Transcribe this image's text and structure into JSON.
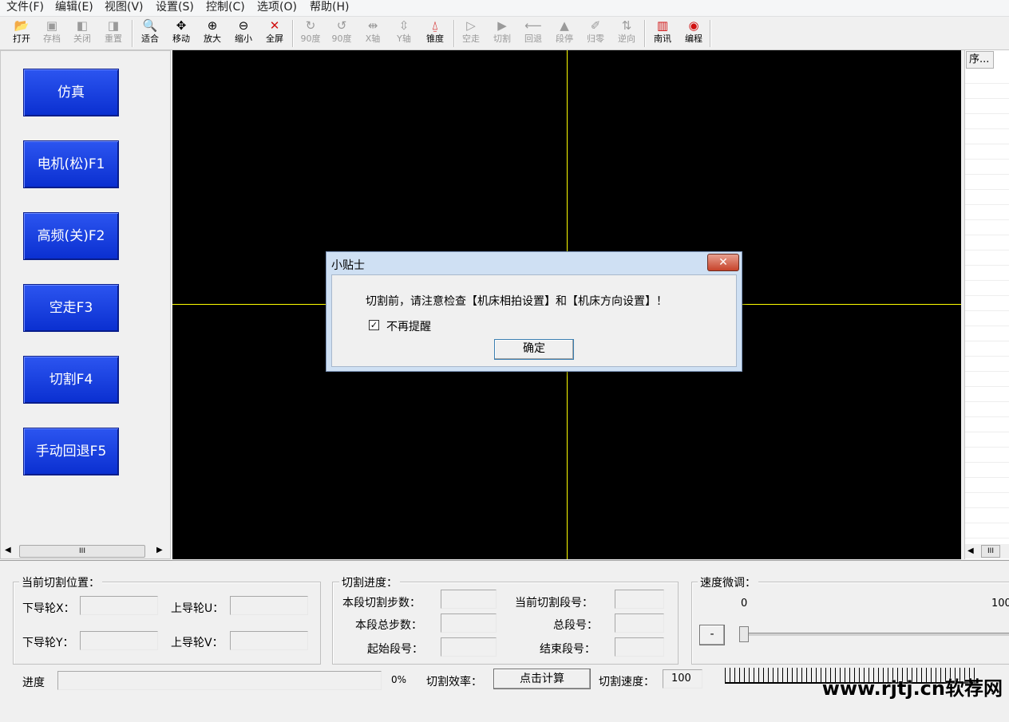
{
  "menu": [
    "文件(F)",
    "编辑(E)",
    "视图(V)",
    "设置(S)",
    "控制(C)",
    "选项(O)",
    "帮助(H)"
  ],
  "toolbar": {
    "open": "打开",
    "save": "存档",
    "close": "关闭",
    "reset": "重置",
    "fit": "适合",
    "move": "移动",
    "zoom_in": "放大",
    "zoom_out": "缩小",
    "fullscreen": "全屏",
    "rot_cw": "90度",
    "rot_ccw": "90度",
    "x_axis": "X轴",
    "y_axis": "Y轴",
    "taper": "锥度",
    "idle_run": "空走",
    "cut": "切割",
    "retreat": "回退",
    "seg_stop": "段停",
    "home": "归零",
    "reverse": "逆向",
    "nanxun": "南讯",
    "program": "编程"
  },
  "left_buttons": [
    "仿真",
    "电机(松)F1",
    "高频(关)F2",
    "空走F3",
    "切割F4",
    "手动回退F5"
  ],
  "left_scroll_thumb": "III",
  "right_list": {
    "header": "序...",
    "scroll_thumb": "III"
  },
  "position_group": {
    "title": "当前切割位置：",
    "lower_x": "下导轮X：",
    "upper_u": "上导轮U：",
    "lower_y": "下导轮Y：",
    "upper_v": "上导轮V："
  },
  "progress_group": {
    "title": "切割进度：",
    "seg_cut_steps": "本段切割步数：",
    "cur_seg_no": "当前切割段号：",
    "seg_total_steps": "本段总步数：",
    "total_segs": "总段号：",
    "start_seg": "起始段号：",
    "end_seg": "结束段号："
  },
  "speed_group": {
    "title": "速度微调：",
    "min": "0",
    "max": "100",
    "minus": "-",
    "level": 0
  },
  "status": {
    "progress_label": "进度",
    "progress_value": "0%",
    "efficiency_label": "切割效率：",
    "calc_button": "点击计算",
    "speed_label": "切割速度：",
    "speed_value": "100"
  },
  "dialog": {
    "title": "小贴士",
    "message": "切割前，请注意检查【机床相拍设置】和【机床方向设置】！",
    "checkbox_label": "不再提醒",
    "checkbox_checked": true,
    "ok": "确定"
  },
  "watermark": "www.rjtj.cn软荐网",
  "colors": {
    "canvas": "#000000",
    "crosshair": "#ffff00",
    "left_button": "#1a3fe0"
  }
}
